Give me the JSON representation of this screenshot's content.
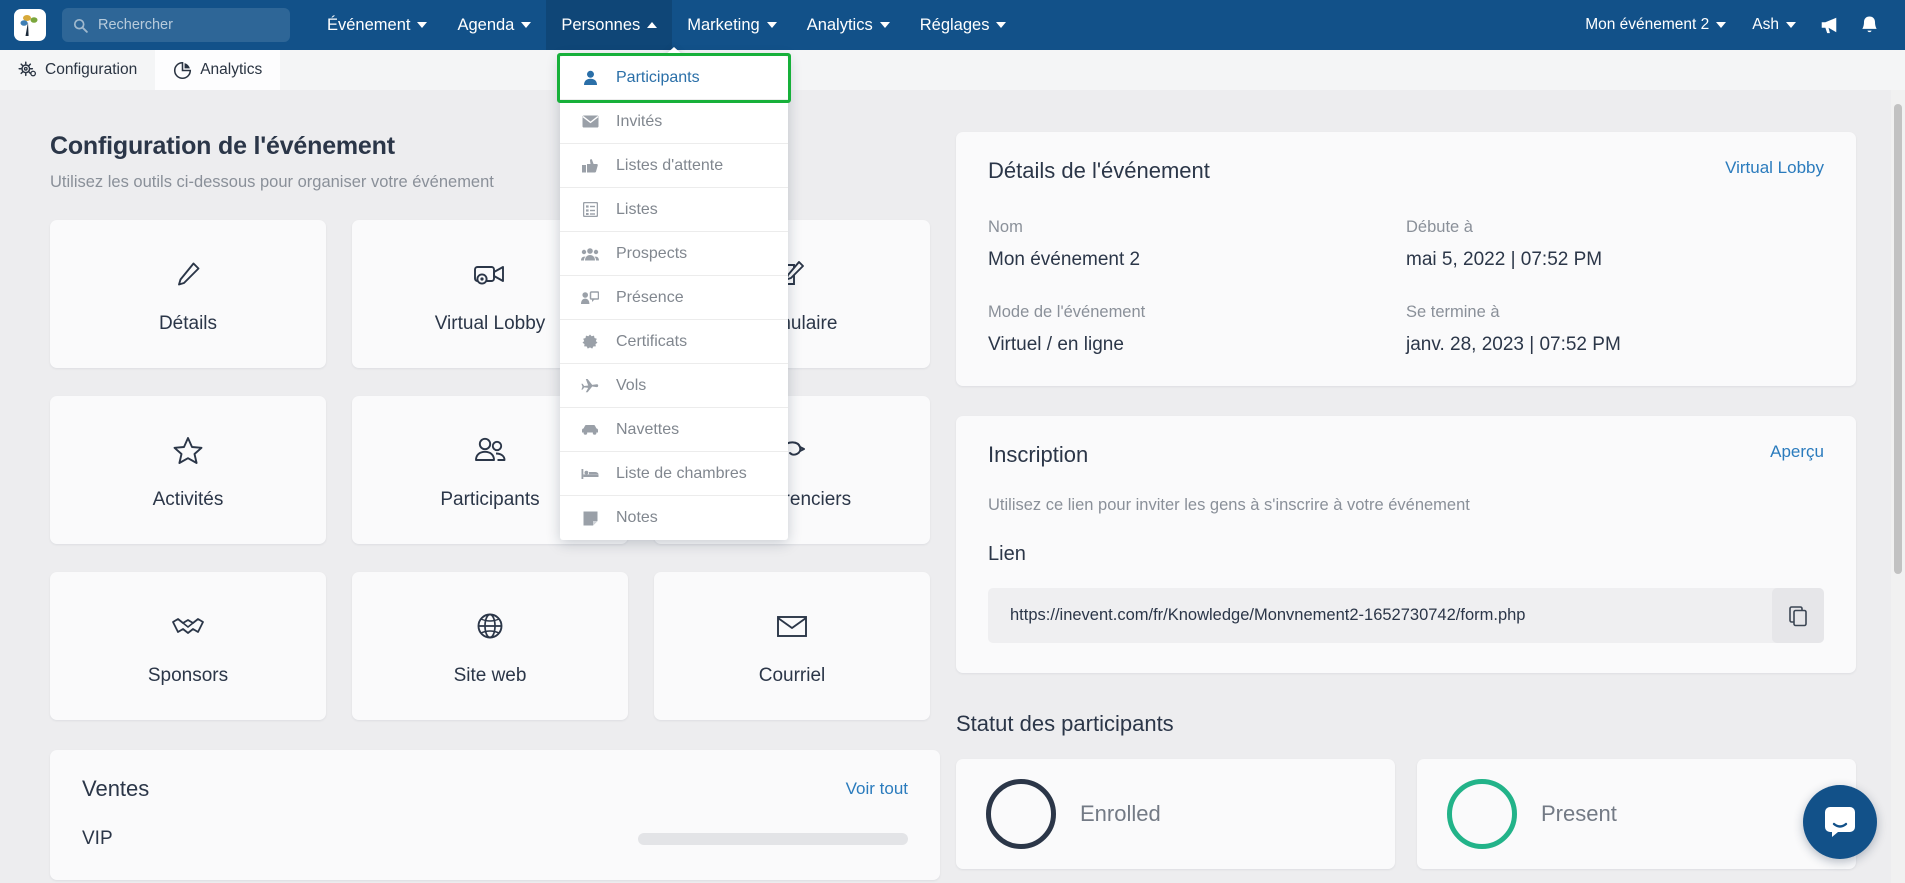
{
  "colors": {
    "navbar": "#125189",
    "accent_link": "#2a7bbd",
    "highlight_green": "#17b03a",
    "present_green": "#22b389",
    "enrolled_dark": "#2b3648"
  },
  "topnav": {
    "logo_icon": "inevent-logo-icon",
    "search": {
      "placeholder": "Rechercher",
      "value": "",
      "icon": "search-icon"
    },
    "items": [
      {
        "label": "Événement",
        "caret": "down"
      },
      {
        "label": "Agenda",
        "caret": "down"
      },
      {
        "label": "Personnes",
        "caret": "up"
      },
      {
        "label": "Marketing",
        "caret": "down"
      },
      {
        "label": "Analytics",
        "caret": "down"
      },
      {
        "label": "Réglages",
        "caret": "down"
      }
    ],
    "right": {
      "event_selector": "Mon événement 2",
      "user": "Ash",
      "announce_icon": "megaphone-icon",
      "bell_icon": "bell-icon"
    }
  },
  "tabs": [
    {
      "label": "Configuration",
      "icon": "gears-icon",
      "selected": false
    },
    {
      "label": "Analytics",
      "icon": "pie-chart-icon",
      "selected": true
    }
  ],
  "dropdown": {
    "open_for": "Personnes",
    "items": [
      {
        "label": "Participants",
        "icon": "person-icon",
        "highlighted": true
      },
      {
        "label": "Invités",
        "icon": "envelope-icon",
        "highlighted": false
      },
      {
        "label": "Listes d'attente",
        "icon": "thumbs-up-icon",
        "highlighted": false
      },
      {
        "label": "Listes",
        "icon": "list-icon",
        "highlighted": false
      },
      {
        "label": "Prospects",
        "icon": "people-group-icon",
        "highlighted": false
      },
      {
        "label": "Présence",
        "icon": "presence-icon",
        "highlighted": false
      },
      {
        "label": "Certificats",
        "icon": "certificate-icon",
        "highlighted": false
      },
      {
        "label": "Vols",
        "icon": "airplane-icon",
        "highlighted": false
      },
      {
        "label": "Navettes",
        "icon": "car-icon",
        "highlighted": false
      },
      {
        "label": "Liste de chambres",
        "icon": "bed-icon",
        "highlighted": false
      },
      {
        "label": "Notes",
        "icon": "note-icon",
        "highlighted": false
      }
    ]
  },
  "page": {
    "title": "Configuration de l'événement",
    "subtitle": "Utilisez les outils ci-dessous pour organiser votre événement",
    "tiles": [
      {
        "label": "Détails",
        "icon": "pencil-icon"
      },
      {
        "label": "Virtual Lobby",
        "icon": "video-gear-icon"
      },
      {
        "label": "Formulaire",
        "icon": "form-edit-icon"
      },
      {
        "label": "Activités",
        "icon": "star-icon"
      },
      {
        "label": "Participants",
        "icon": "people-icon"
      },
      {
        "label": "Conférenciers",
        "icon": "speaker-icon"
      },
      {
        "label": "Sponsors",
        "icon": "handshake-icon"
      },
      {
        "label": "Site web",
        "icon": "globe-icon"
      },
      {
        "label": "Courriel",
        "icon": "mail-icon"
      }
    ]
  },
  "event_details": {
    "title": "Détails de l'événement",
    "link_label": "Virtual Lobby",
    "fields": [
      {
        "key": "Nom",
        "value": "Mon événement 2"
      },
      {
        "key": "Débute à",
        "value": "mai 5, 2022 | 07:52 PM"
      },
      {
        "key": "Mode de l'événement",
        "value": "Virtuel / en ligne"
      },
      {
        "key": "Se termine à",
        "value": "janv. 28, 2023 | 07:52 PM"
      }
    ]
  },
  "inscription": {
    "title": "Inscription",
    "link_label": "Aperçu",
    "description": "Utilisez ce lien pour inviter les gens à s'inscrire à votre événement",
    "lien_label": "Lien",
    "url": "https://inevent.com/fr/Knowledge/Monvnement2-1652730742/form.php",
    "copy_icon": "copy-icon"
  },
  "participant_status": {
    "title": "Statut des participants",
    "cards": [
      {
        "label": "Enrolled",
        "color": "#2b3648"
      },
      {
        "label": "Present",
        "color": "#22b389"
      }
    ]
  },
  "ventes": {
    "title": "Ventes",
    "link_label": "Voir tout",
    "items": [
      {
        "name": "VIP"
      }
    ]
  },
  "intercom": {
    "icon": "chat-bubble-icon"
  }
}
